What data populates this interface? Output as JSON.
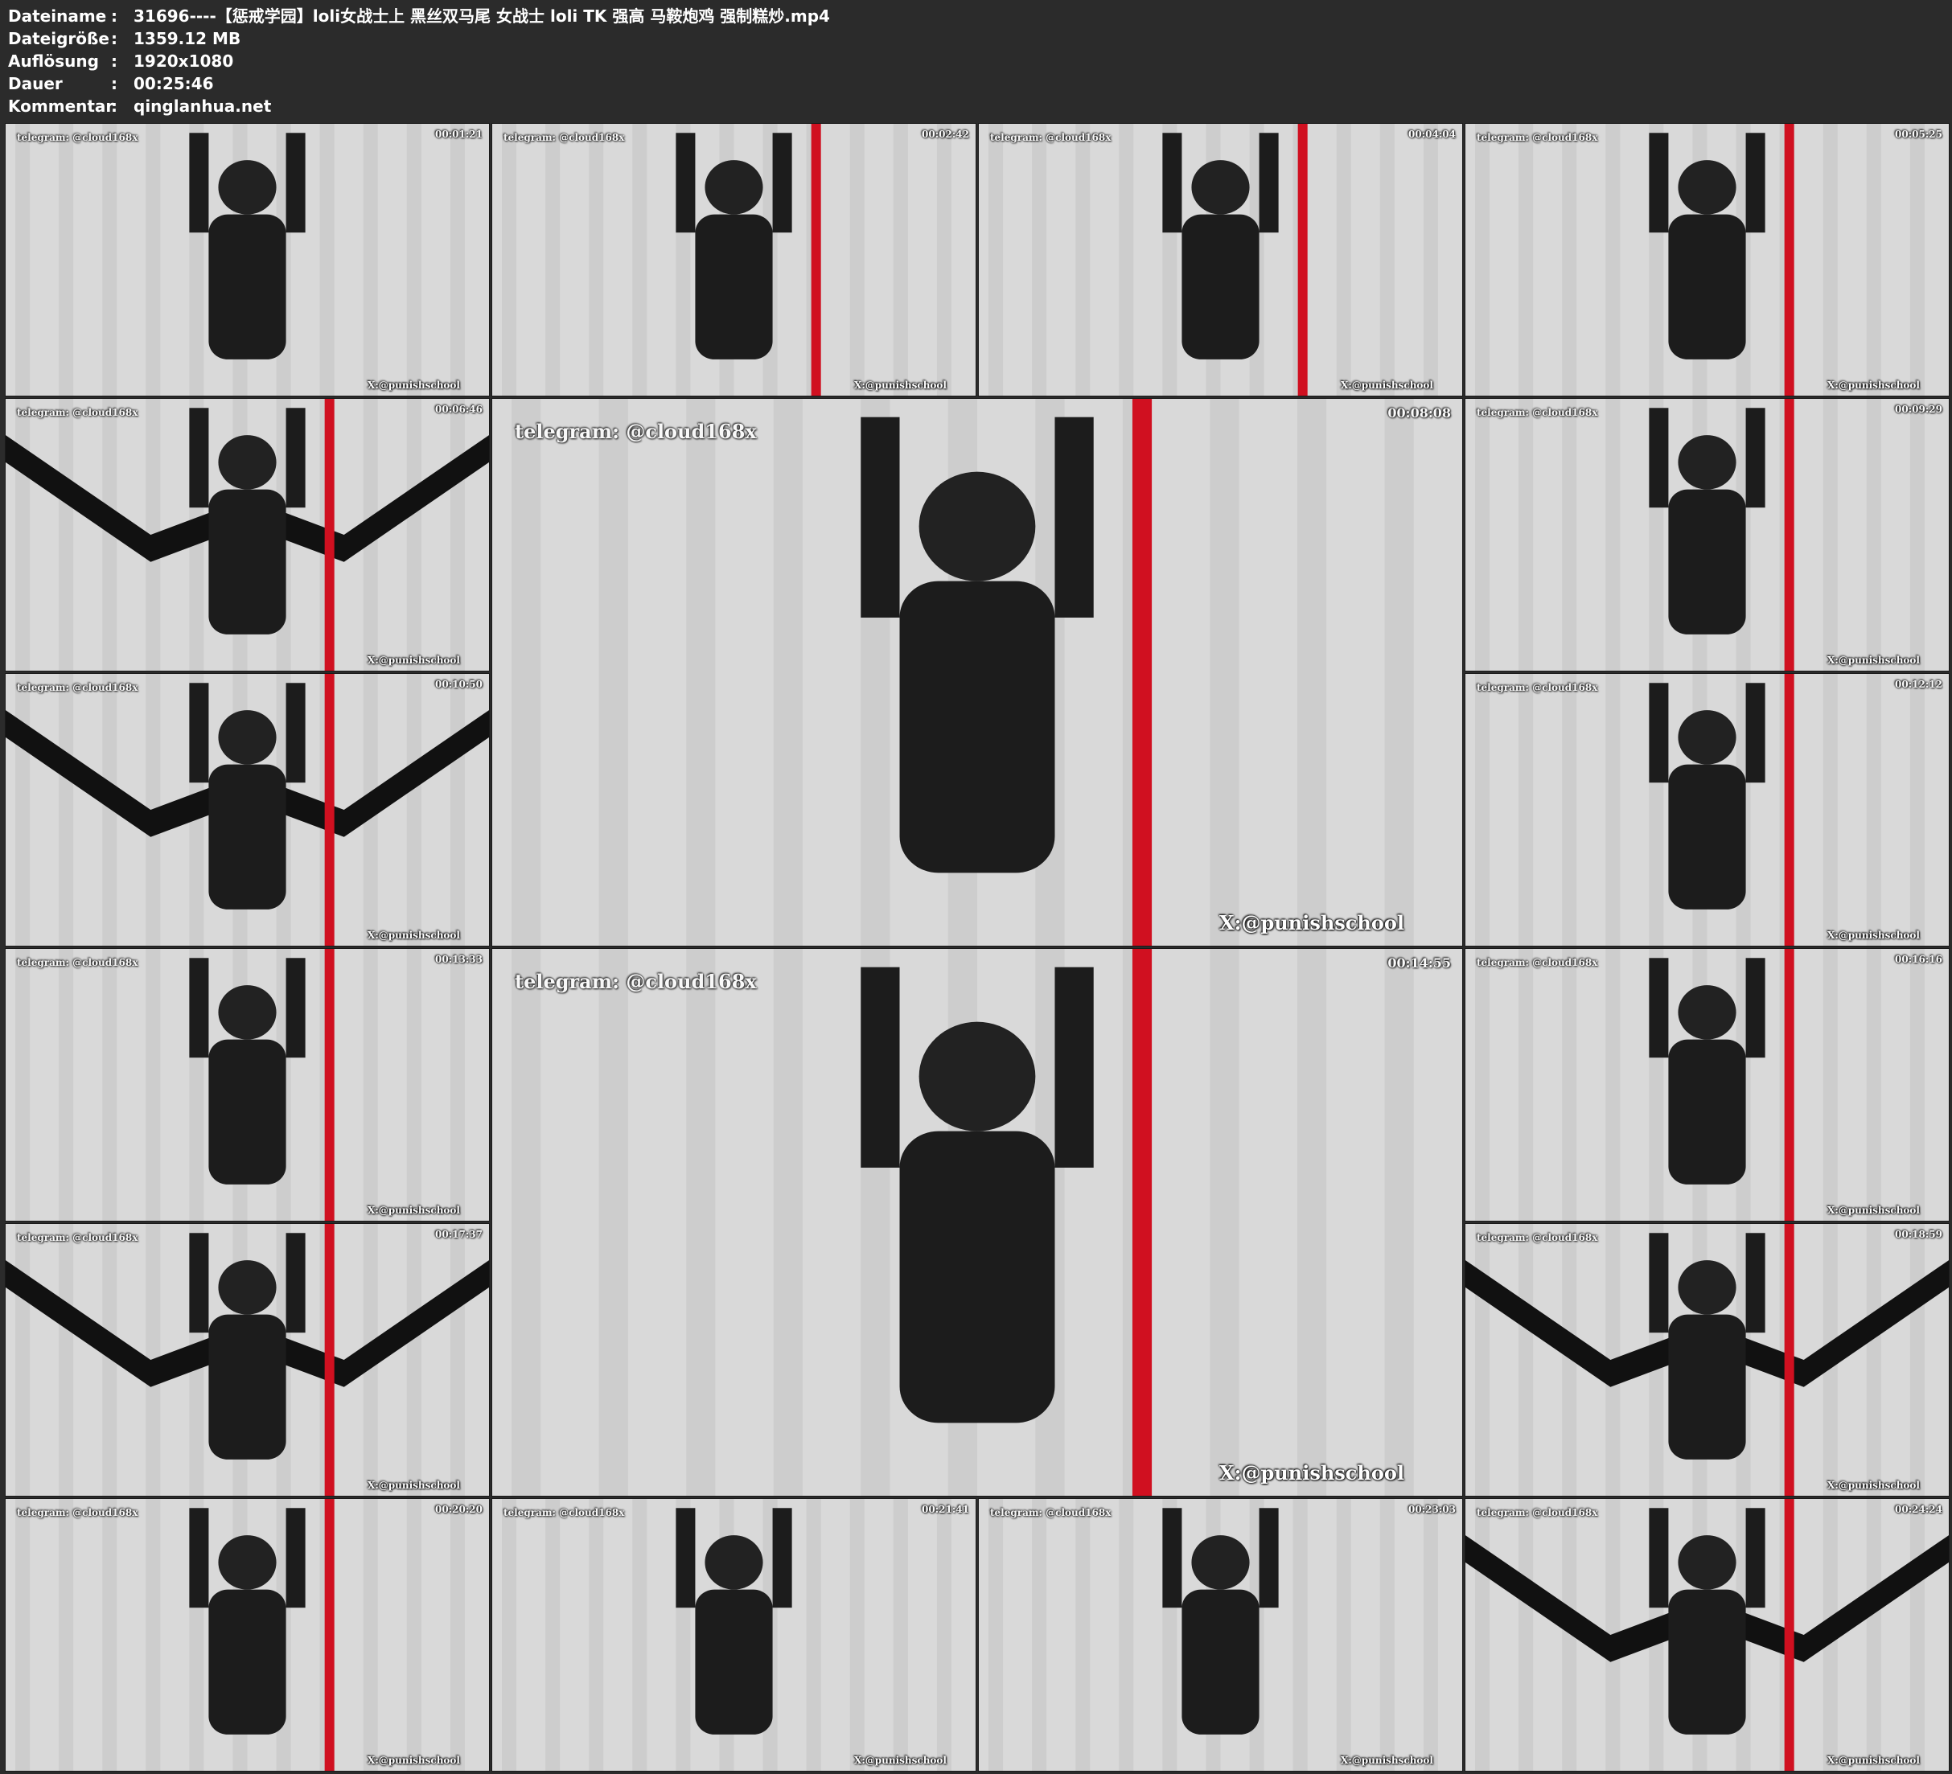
{
  "info": {
    "rows": [
      {
        "label": "Dateiname",
        "sep": ":",
        "value": "31696----【惩戒学园】loli女战士上 黑丝双马尾 女战士 loli TK 强高 马鞍炮鸡 强制糕炒.mp4"
      },
      {
        "label": "Dateigröße",
        "sep": ":",
        "value": "1359.12 MB"
      },
      {
        "label": "Auflösung",
        "sep": ":",
        "value": "1920x1080"
      },
      {
        "label": "Dauer",
        "sep": ":",
        "value": "00:25:46"
      },
      {
        "label": "Kommentar",
        "sep": ":",
        "value": "qinglanhua.net"
      }
    ]
  },
  "watermarks": {
    "telegram": "telegram: @cloud168x",
    "x": "X:@punishschool"
  },
  "thumbnails": [
    {
      "timestamp": "00:01:21"
    },
    {
      "timestamp": "00:02:42"
    },
    {
      "timestamp": "00:04:04"
    },
    {
      "timestamp": "00:05:25"
    },
    {
      "timestamp": "00:06:46"
    },
    {
      "timestamp": "00:08:08"
    },
    {
      "timestamp": "00:09:29"
    },
    {
      "timestamp": "00:10:50"
    },
    {
      "timestamp": "00:12:12"
    },
    {
      "timestamp": "00:13:33"
    },
    {
      "timestamp": "00:14:55"
    },
    {
      "timestamp": "00:16:16"
    },
    {
      "timestamp": "00:17:37"
    },
    {
      "timestamp": "00:18:59"
    },
    {
      "timestamp": "00:20:20"
    },
    {
      "timestamp": "00:21:41"
    },
    {
      "timestamp": "00:23:03"
    },
    {
      "timestamp": "00:24:24"
    }
  ],
  "colors": {
    "background": "#2b2b2b",
    "curtain": "#d9d9d9",
    "suit": "#1c1c1c",
    "rope": "#d01020"
  }
}
